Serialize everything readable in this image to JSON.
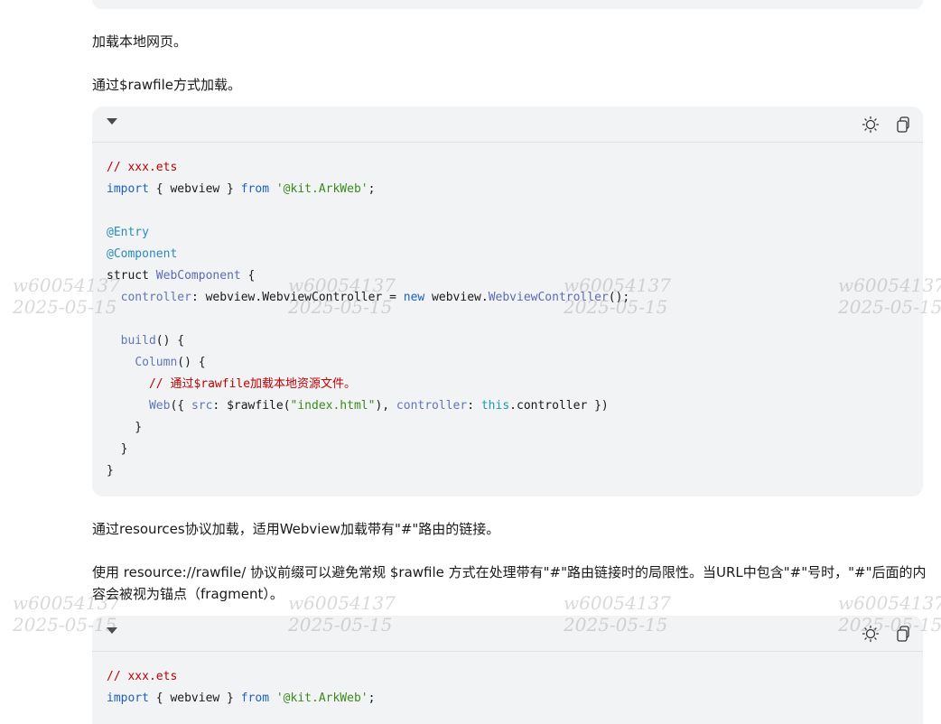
{
  "para1": "加载本地网页。",
  "para2": "通过$rawfile方式加载。",
  "para3": "通过resources协议加载，适用Webview加载带有\"#\"路由的链接。",
  "para4": "使用 resource://rawfile/ 协议前缀可以避免常规 $rawfile 方式在处理带有\"#\"路由链接时的局限性。当URL中包含\"#\"号时，\"#\"后面的内容会被视为锚点（fragment）。",
  "icons": {
    "collapse": "caret-down-icon",
    "theme": "sun-icon",
    "copy": "copy-icon"
  },
  "code1": {
    "line1": "// xxx.ets",
    "l2_kw1": "import",
    "l2_a": " { webview } ",
    "l2_kw2": "from",
    "l2_sp": " ",
    "l2_str": "'@kit.ArkWeb'",
    "l2_end": ";",
    "line4": "@Entry",
    "line5": "@Component",
    "l6_a": "struct ",
    "l6_type": "WebComponent",
    "l6_b": " {",
    "l7_ind": "  ",
    "l7_prop": "controller",
    "l7_a": ": webview.WebviewController = ",
    "l7_kw": "new",
    "l7_b": " webview.",
    "l7_type": "WebviewController",
    "l7_c": "();",
    "l9_ind": "  ",
    "l9_prop": "build",
    "l9_a": "() {",
    "l10_ind": "    ",
    "l10_prop": "Column",
    "l10_a": "() {",
    "l11_ind": "      ",
    "l11_com": "// 通过$rawfile加载本地资源文件。",
    "l12_ind": "      ",
    "l12_prop": "Web",
    "l12_a": "({ ",
    "l12_p2": "src",
    "l12_b": ": $rawfile(",
    "l12_str": "\"index.html\"",
    "l12_c": "), ",
    "l12_p3": "controller",
    "l12_d": ": ",
    "l12_this": "this",
    "l12_e": ".controller })",
    "line13": "    }",
    "line14": "  }",
    "line15": "}"
  },
  "code2": {
    "line1": "// xxx.ets",
    "l2_kw1": "import",
    "l2_a": " { webview } ",
    "l2_kw2": "from",
    "l2_sp": " ",
    "l2_str": "'@kit.ArkWeb'",
    "l2_end": ";"
  },
  "watermark": {
    "id": "w60054137",
    "date": "2025-05-15"
  }
}
